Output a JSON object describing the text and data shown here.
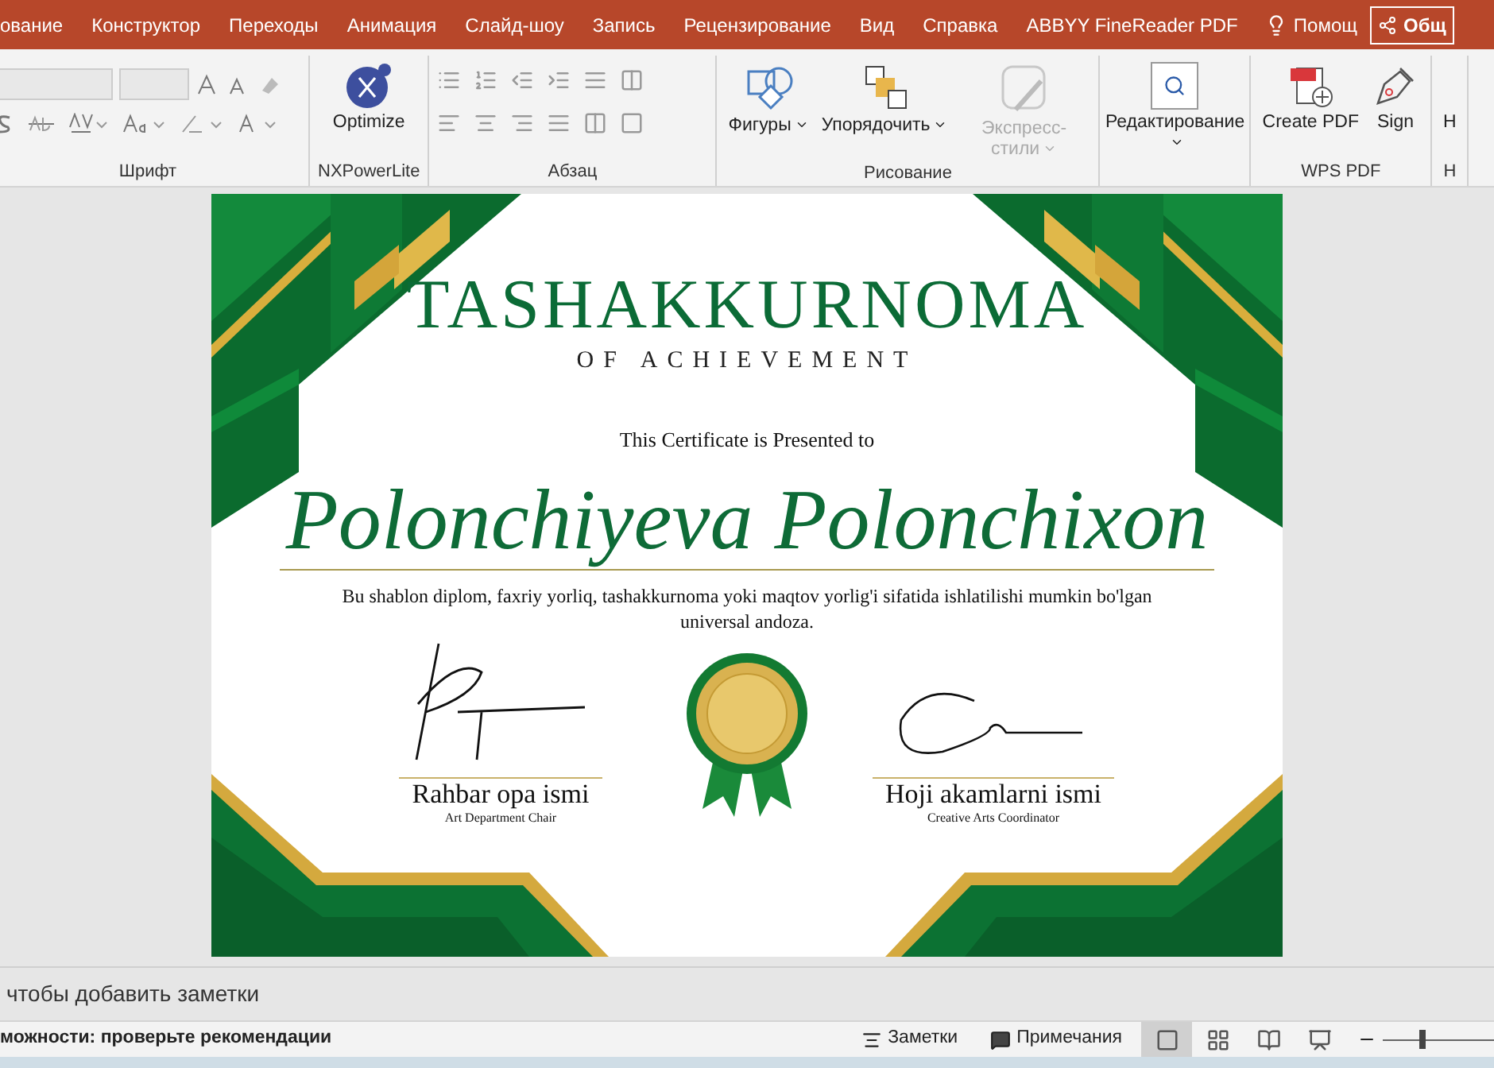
{
  "tabs": [
    {
      "label": "ование",
      "selected": false
    },
    {
      "label": "Конструктор",
      "selected": false
    },
    {
      "label": "Переходы",
      "selected": false
    },
    {
      "label": "Анимация",
      "selected": false
    },
    {
      "label": "Слайд-шоу",
      "selected": false
    },
    {
      "label": "Запись",
      "selected": false
    },
    {
      "label": "Рецензирование",
      "selected": false
    },
    {
      "label": "Вид",
      "selected": false
    },
    {
      "label": "Справка",
      "selected": false
    },
    {
      "label": "ABBYY FineReader PDF",
      "selected": false
    }
  ],
  "help": "Помощ",
  "share": "Общ",
  "ribbon": {
    "groups": [
      {
        "kind": "font",
        "label": "Шрифт"
      },
      {
        "kind": "buttons",
        "label": "NXPowerLite",
        "buttons": [
          {
            "kind": "optimize",
            "label": "Optimize",
            "disabled": false,
            "dropdown": false
          }
        ]
      },
      {
        "kind": "paragraph",
        "label": "Абзац"
      },
      {
        "kind": "buttons",
        "label": "Рисование",
        "buttons": [
          {
            "kind": "shapes",
            "label": "Фигуры",
            "disabled": false,
            "dropdown": true
          },
          {
            "kind": "arrange",
            "label": "Упорядочить",
            "disabled": false,
            "dropdown": true
          },
          {
            "kind": "styles",
            "label": "Экспресс-стили",
            "disabled": true,
            "dropdown": true
          }
        ]
      },
      {
        "kind": "buttons",
        "buttons": [
          {
            "kind": "find",
            "label": "Редактирование",
            "disabled": false,
            "dropdown": true
          }
        ]
      },
      {
        "kind": "buttons",
        "label": "WPS PDF",
        "buttons": [
          {
            "kind": "pdf",
            "label": "Create PDF",
            "disabled": false,
            "dropdown": false
          },
          {
            "kind": "sign",
            "label": "Sign",
            "disabled": false,
            "dropdown": false
          }
        ]
      },
      {
        "kind": "buttons",
        "label": "Н",
        "buttons": [
          {
            "kind": "plain",
            "label": "Н",
            "disabled": false,
            "dropdown": false
          }
        ]
      }
    ]
  },
  "slide": {
    "title": "TASHAKKURNOMA",
    "subtitle": "OF ACHIEVEMENT",
    "presented": "This Certificate is Presented to",
    "name": "Polonchiyeva Polonchixon",
    "description": "Bu shablon diplom, faxriy yorliq, tashakkurnoma yoki maqtov yorlig'i sifatida ishlatilishi mumkin bo'lgan universal andoza.",
    "signatures": [
      {
        "name": "Rahbar opa ismi",
        "role": "Art Department Chair"
      },
      {
        "name": "Hoji akamlarni ismi",
        "role": "Creative Arts Coordinator"
      }
    ]
  },
  "notes": {
    "placeholder": "чтобы добавить заметки"
  },
  "status_bar": {
    "message": "можности: проверьте рекомендации",
    "buttons": [
      {
        "label": "Заметки"
      },
      {
        "label": "Примечания"
      }
    ],
    "views": [
      {
        "selected": true
      },
      {
        "selected": false
      },
      {
        "selected": false
      },
      {
        "selected": false
      }
    ],
    "zoom": {
      "level": 0.33
    }
  }
}
